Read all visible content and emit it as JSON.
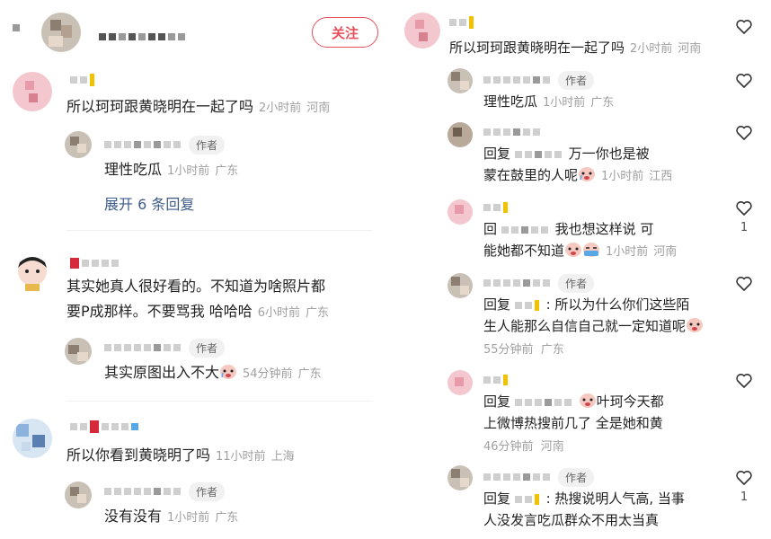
{
  "header": {
    "follow_label": "关注"
  },
  "left": {
    "comments": [
      {
        "text": "所以珂珂跟黄晓明在一起了吗",
        "time": "2小时前",
        "location": "河南",
        "reply": {
          "author_tag": "作者",
          "text": "理性吃瓜",
          "time": "1小时前",
          "location": "广东"
        },
        "expand": "展开 6 条回复"
      },
      {
        "text_line1": "其实她真人很好看的。不知道为啥照片都",
        "text_line2": "要P成那样。不要骂我 哈哈哈",
        "time": "6小时前",
        "location": "广东",
        "reply": {
          "author_tag": "作者",
          "text": "其实原图出入不大",
          "time": "54分钟前",
          "location": "广东"
        }
      },
      {
        "text": "所以你看到黄晓明了吗",
        "time": "11小时前",
        "location": "上海",
        "reply": {
          "author_tag": "作者",
          "text": "没有没有",
          "time": "1小时前",
          "location": "广东"
        }
      }
    ]
  },
  "right": {
    "top": {
      "text": "所以珂珂跟黄晓明在一起了吗",
      "time": "2小时前",
      "location": "河南"
    },
    "replies": [
      {
        "author_tag": "作者",
        "text": "理性吃瓜",
        "time": "1小时前",
        "location": "广东"
      },
      {
        "line1_prefix": "回复",
        "line1_rest": "万一你也是被",
        "line2": "蒙在鼓里的人呢",
        "time": "1小时前",
        "location": "江西"
      },
      {
        "line1_prefix": "回",
        "line1_rest": "我也想这样说 可",
        "line2": "能她都不知道",
        "time": "1小时前",
        "location": "河南",
        "likes": "1"
      },
      {
        "author_tag": "作者",
        "line1_prefix": "回复",
        "line1_rest": ": 所以为什么你们这些陌",
        "line2": "生人能那么自信自己就一定知道呢",
        "time": "55分钟前",
        "location": "广东"
      },
      {
        "line1_prefix": "回复",
        "line1_rest": "叶珂今天都",
        "line2": "上微博热搜前几了 全是她和黄",
        "time": "46分钟前",
        "location": "河南"
      },
      {
        "author_tag": "作者",
        "line1_prefix": "回复",
        "line1_rest": ": 热搜说明人气高, 当事",
        "line2": "人没发言吃瓜群众不用太当真",
        "likes": "1"
      }
    ]
  },
  "colors": {
    "accent": "#e8505b",
    "link": "#3e5b8a",
    "meta": "#a0a0a0"
  },
  "icons": [
    "heart-outline-icon",
    "crying-face-emoji",
    "tearful-face-emoji"
  ]
}
